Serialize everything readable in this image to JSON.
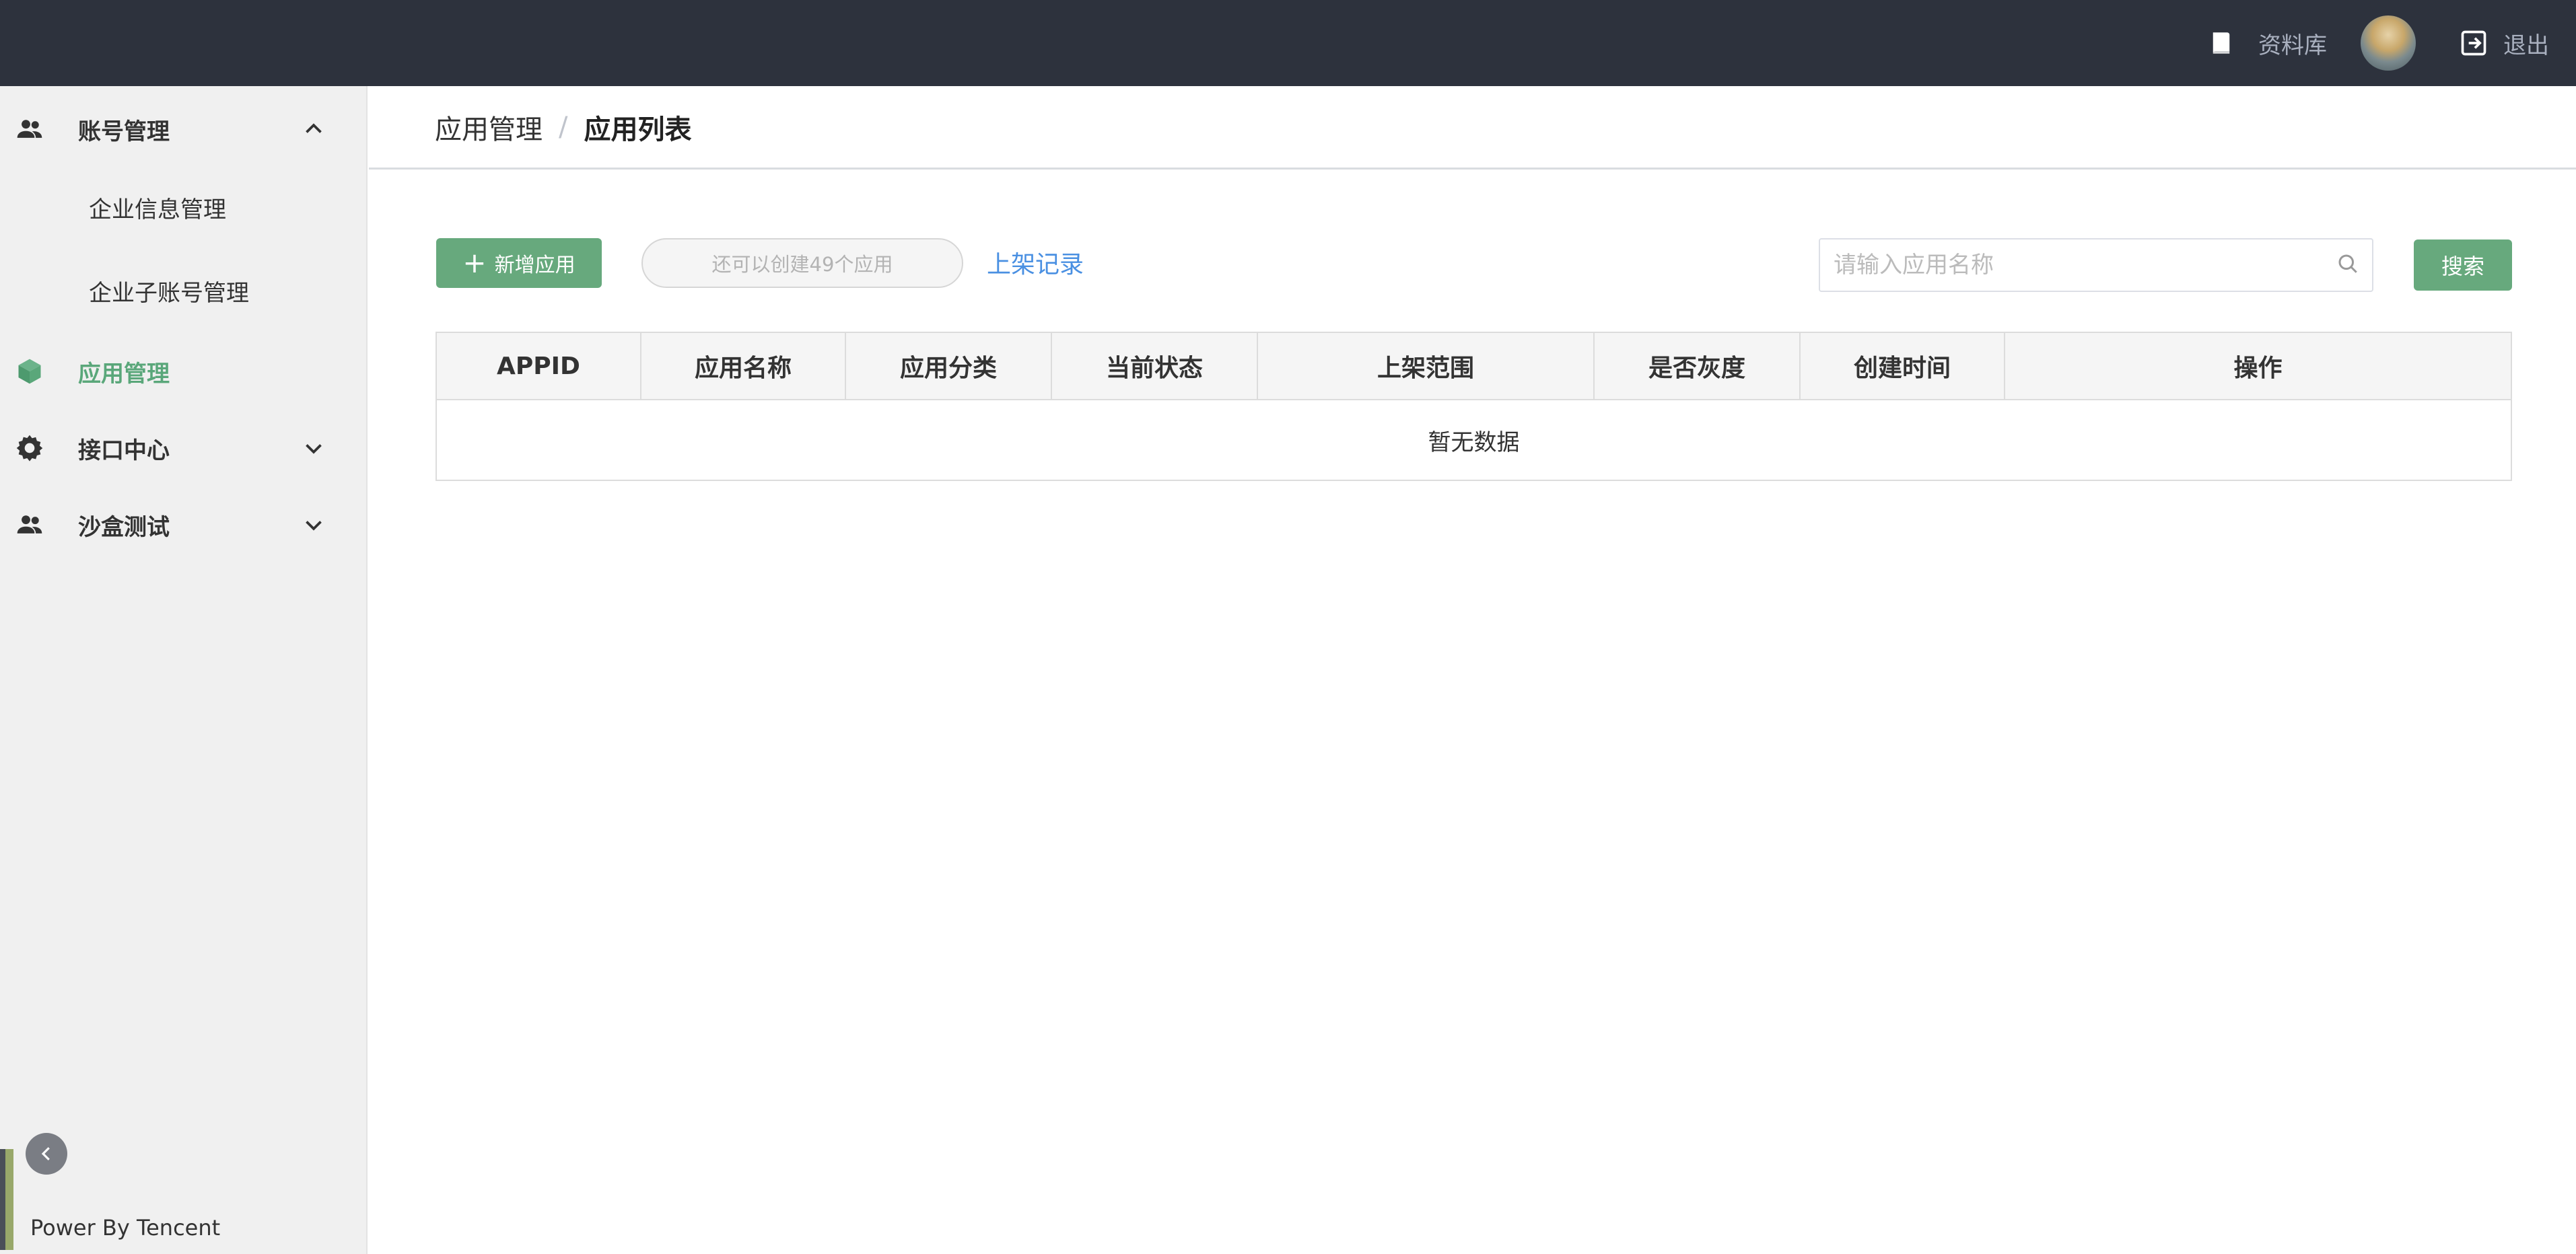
{
  "topbar": {
    "library_label": "资料库",
    "logout_label": "退出"
  },
  "sidebar": {
    "groups": [
      {
        "label": "账号管理",
        "expanded": true,
        "icon": "users-icon"
      },
      {
        "label": "应用管理",
        "active": true,
        "icon": "cube-icon"
      },
      {
        "label": "接口中心",
        "expanded": false,
        "icon": "gear-icon"
      },
      {
        "label": "沙盒测试",
        "expanded": false,
        "icon": "users-icon"
      }
    ],
    "subitems": [
      {
        "label": "企业信息管理"
      },
      {
        "label": "企业子账号管理"
      }
    ],
    "footer": "Power By Tencent"
  },
  "breadcrumb": {
    "parent": "应用管理",
    "separator": "/",
    "current": "应用列表"
  },
  "toolbar": {
    "add_label": "新增应用",
    "quota_text": "还可以创建49个应用",
    "records_link": "上架记录",
    "search_placeholder": "请输入应用名称",
    "search_button": "搜索"
  },
  "table": {
    "columns": [
      "APPID",
      "应用名称",
      "应用分类",
      "当前状态",
      "上架范围",
      "是否灰度",
      "创建时间",
      "操作"
    ],
    "empty_text": "暂无数据"
  },
  "colors": {
    "topbar": "#2d323d",
    "accent_green": "#67a97d",
    "active_menu": "#5aa77a",
    "link_blue": "#4a90e2"
  }
}
